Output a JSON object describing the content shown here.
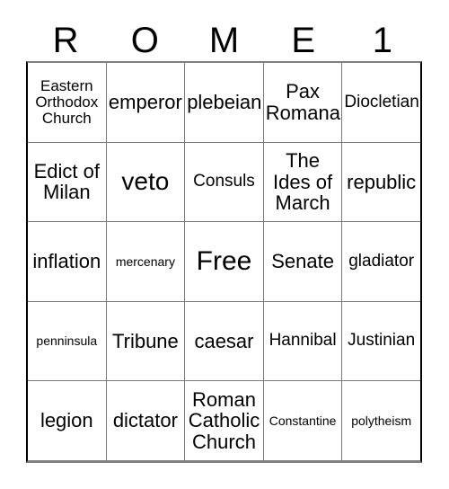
{
  "card": {
    "title_letters": [
      "R",
      "O",
      "M",
      "E",
      "1"
    ],
    "grid": {
      "columns": 5,
      "rows": 5,
      "cells": [
        [
          {
            "label": "Eastern Orthodox Church",
            "size": "xs"
          },
          {
            "label": "emperor",
            "size": "md"
          },
          {
            "label": "plebeian",
            "size": "md"
          },
          {
            "label": "Pax Romana",
            "size": "md"
          },
          {
            "label": "Diocletian",
            "size": "sm"
          }
        ],
        [
          {
            "label": "Edict of Milan",
            "size": "md"
          },
          {
            "label": "veto",
            "size": "lg"
          },
          {
            "label": "Consuls",
            "size": "sm"
          },
          {
            "label": "The Ides of March",
            "size": "md"
          },
          {
            "label": "republic",
            "size": "md"
          }
        ],
        [
          {
            "label": "inflation",
            "size": "md"
          },
          {
            "label": "mercenary",
            "size": "xxs"
          },
          {
            "label": "Free",
            "size": "xl"
          },
          {
            "label": "Senate",
            "size": "md"
          },
          {
            "label": "gladiator",
            "size": "sm"
          }
        ],
        [
          {
            "label": "penninsula",
            "size": "xxs"
          },
          {
            "label": "Tribune",
            "size": "md"
          },
          {
            "label": "caesar",
            "size": "md"
          },
          {
            "label": "Hannibal",
            "size": "sm"
          },
          {
            "label": "Justinian",
            "size": "sm"
          }
        ],
        [
          {
            "label": "legion",
            "size": "md"
          },
          {
            "label": "dictator",
            "size": "md"
          },
          {
            "label": "Roman Catholic Church",
            "size": "md"
          },
          {
            "label": "Constantine",
            "size": "xxs"
          },
          {
            "label": "polytheism",
            "size": "xxs"
          }
        ]
      ]
    },
    "colors": {
      "background": "#ffffff",
      "text": "#000000",
      "grid_line": "#7a7a7a",
      "grid_border": "#000000"
    }
  }
}
